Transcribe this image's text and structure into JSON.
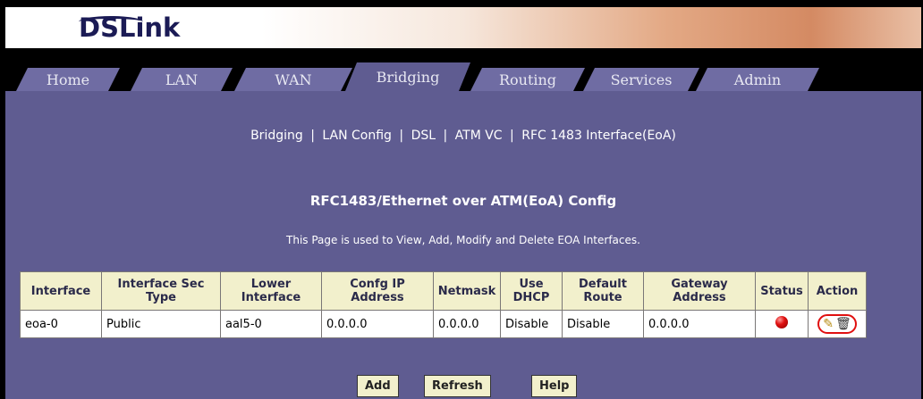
{
  "logo": "DSLink",
  "tabs": [
    {
      "label": "Home"
    },
    {
      "label": "LAN"
    },
    {
      "label": "WAN"
    },
    {
      "label": "Bridging"
    },
    {
      "label": "Routing"
    },
    {
      "label": "Services"
    },
    {
      "label": "Admin"
    }
  ],
  "subnav": {
    "items": [
      "Bridging",
      "LAN Config",
      "DSL",
      "ATM VC",
      "RFC 1483 Interface(EoA)"
    ],
    "separator": "|"
  },
  "page": {
    "title": "RFC1483/Ethernet over ATM(EoA) Config",
    "description": "This Page is used to View, Add, Modify and Delete EOA Interfaces."
  },
  "table": {
    "headers": [
      "Interface",
      "Interface Sec Type",
      "Lower Interface",
      "Confg IP Address",
      "Netmask",
      "Use DHCP",
      "Default Route",
      "Gateway Address",
      "Status",
      "Action"
    ],
    "rows": [
      {
        "interface": "eoa-0",
        "sec_type": "Public",
        "lower_interface": "aal5-0",
        "ip_address": "0.0.0.0",
        "netmask": "0.0.0.0",
        "use_dhcp": "Disable",
        "default_route": "Disable",
        "gateway": "0.0.0.0",
        "status": "red-status-icon",
        "action_icons": [
          "pencil-icon",
          "trash-icon"
        ]
      }
    ]
  },
  "buttons": {
    "add": "Add",
    "refresh": "Refresh",
    "help": "Help"
  },
  "colors": {
    "background": "#5f5c91",
    "table_header": "#f2f0cc",
    "status_red": "#e01010"
  }
}
